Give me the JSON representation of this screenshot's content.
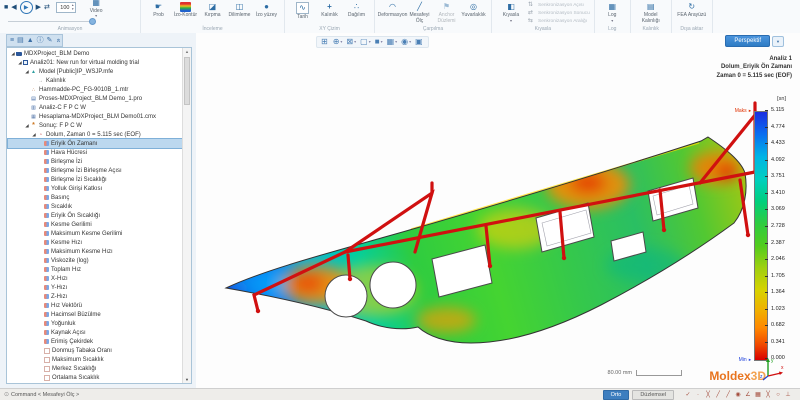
{
  "ribbon": {
    "animation": {
      "label": "Animasyon",
      "value": "100",
      "icons": {
        "stop": "■",
        "prev": "◀",
        "play": "▶",
        "next": "▶",
        "loop": "⇄"
      },
      "video": {
        "label": "Video",
        "glyph": "▦"
      }
    },
    "inceleme": {
      "label": "İnceleme",
      "buttons": [
        {
          "name": "prob-button",
          "label": "Prob",
          "glyph": "☛"
        },
        {
          "name": "izo-kontur-button",
          "label": "İzo-Kontür",
          "glyph": "",
          "iconclass": "rainbow"
        },
        {
          "name": "kirpma-button",
          "label": "Kırpma",
          "glyph": "◪"
        },
        {
          "name": "dilimleme-button",
          "label": "Dilimleme",
          "glyph": "◫"
        },
        {
          "name": "izo-yuzey-button",
          "label": "İzo yüzey",
          "glyph": "●"
        }
      ]
    },
    "xy": {
      "label": "XY Çizim",
      "buttons": [
        {
          "name": "tarih-button",
          "label": "Tarih",
          "glyph": "∿",
          "iconclass": "chart"
        },
        {
          "name": "kalinlik-button",
          "label": "Kalınlık",
          "glyph": "+",
          "iconclass": "red"
        },
        {
          "name": "dagilim-button",
          "label": "Dağılım",
          "glyph": "∴"
        }
      ]
    },
    "carpilma": {
      "label": "Çarpılma",
      "buttons": [
        {
          "name": "deformasyon-button",
          "label": "Deformasyon",
          "glyph": "◠"
        },
        {
          "name": "mesafeyi-olc-button",
          "label": "Mesafeyi Ölç",
          "glyph": "╱"
        },
        {
          "name": "anchor-duzlemi-button",
          "label": "Anchor Düzlemi",
          "glyph": "⚑",
          "disabled": true
        },
        {
          "name": "yuvarlaklik-button",
          "label": "Yuvarlaklık",
          "glyph": "◎",
          "iconclass": "red"
        }
      ]
    },
    "kiyasla": {
      "label": "Kıyasla",
      "main": {
        "label": "Kıyasla",
        "glyph": "◧"
      },
      "subs": [
        {
          "name": "senkronizasyon-acisi-button",
          "label": "Senkronizasyon Açısı",
          "glyph": "⇅",
          "disabled": true
        },
        {
          "name": "senkronizasyon-sonucu-button",
          "label": "Senkronizasyon Sonucu",
          "glyph": "⇄",
          "disabled": true
        },
        {
          "name": "senkronizasyon-araligi-button",
          "label": "Senkronizasyon Aralığı",
          "glyph": "⇆",
          "disabled": true
        }
      ]
    },
    "log": {
      "label": "Log",
      "button": {
        "label": "Log",
        "glyph": "▦"
      }
    },
    "kalinlik": {
      "label": "Kalınlık",
      "button": {
        "label": "Model Kalınlığı",
        "glyph": "▤",
        "iconclass": "tan"
      }
    },
    "disa": {
      "label": "Dışa aktar",
      "button": {
        "label": "FEA Arayüzü",
        "glyph": "↻"
      }
    }
  },
  "tree": {
    "head_icons": [
      {
        "name": "tree-list-icon",
        "glyph": "≡"
      },
      {
        "name": "tree-layers-icon",
        "glyph": "▤"
      },
      {
        "name": "tree-model-icon",
        "glyph": "▲"
      },
      {
        "name": "tree-info-icon",
        "glyph": "ⓘ"
      },
      {
        "name": "tree-tools-icon",
        "glyph": "✎"
      },
      {
        "name": "collapse-all-icon",
        "glyph": "«",
        "iconclass": "rot90"
      }
    ],
    "items": [
      {
        "label": "MDXProject_BLM Demo",
        "level": 0,
        "icon": "folder",
        "caret": "◢"
      },
      {
        "label": "Analiz01: New run for virtual molding trial",
        "level": 1,
        "icon": "run",
        "caret": "◢"
      },
      {
        "label": "Model [Public]IP_WSJP.mfe",
        "level": 2,
        "icon": "model",
        "caret": "◢"
      },
      {
        "label": "Kalınlık",
        "level": 3,
        "icon": "thick",
        "caret": ""
      },
      {
        "label": "Hammadde-PC_FG-9010B_1.mtr",
        "level": 2,
        "icon": "mtr",
        "caret": ""
      },
      {
        "label": "Proses-MDXProject_BLM Demo_1.pro",
        "level": 2,
        "icon": "pro",
        "caret": ""
      },
      {
        "label": "Analiz-C F P C W",
        "level": 2,
        "icon": "ana",
        "caret": ""
      },
      {
        "label": "Hesaplama-MDXProject_BLM Demo01.cmx",
        "level": 2,
        "icon": "cmx",
        "caret": ""
      },
      {
        "label": "Sonuç: F P C W",
        "level": 2,
        "icon": "res",
        "caret": "◢"
      },
      {
        "label": "Dolum, Zaman 0 = 5.115 sec (EOF)",
        "level": 3,
        "icon": "fill",
        "caret": "◢"
      },
      {
        "label": "Eriyik Ön Zamanı",
        "level": 4,
        "icon": "item",
        "caret": "",
        "selected": true
      },
      {
        "label": "Hava Hücresi",
        "level": 4,
        "icon": "item",
        "caret": ""
      },
      {
        "label": "Birleşme İzi",
        "level": 4,
        "icon": "item",
        "caret": ""
      },
      {
        "label": "Birleşme İzi Birleşme Açısı",
        "level": 4,
        "icon": "item",
        "caret": ""
      },
      {
        "label": "Birleşme İzi Sıcaklığı",
        "level": 4,
        "icon": "item",
        "caret": ""
      },
      {
        "label": "Yolluk Girişi Katkısı",
        "level": 4,
        "icon": "item",
        "caret": ""
      },
      {
        "label": "Basınç",
        "level": 4,
        "icon": "item",
        "caret": ""
      },
      {
        "label": "Sıcaklık",
        "level": 4,
        "icon": "item",
        "caret": ""
      },
      {
        "label": "Eriyik Ön Sıcaklığı",
        "level": 4,
        "icon": "item",
        "caret": ""
      },
      {
        "label": "Kesme Gerilimi",
        "level": 4,
        "icon": "item",
        "caret": ""
      },
      {
        "label": "Maksimum Kesme Gerilimi",
        "level": 4,
        "icon": "item",
        "caret": ""
      },
      {
        "label": "Kesme Hızı",
        "level": 4,
        "icon": "item",
        "caret": ""
      },
      {
        "label": "Maksimum Kesme Hızı",
        "level": 4,
        "icon": "item",
        "caret": ""
      },
      {
        "label": "Viskozite (log)",
        "level": 4,
        "icon": "item",
        "caret": ""
      },
      {
        "label": "Toplam Hız",
        "level": 4,
        "icon": "item",
        "caret": ""
      },
      {
        "label": "X-Hızı",
        "level": 4,
        "icon": "item",
        "caret": ""
      },
      {
        "label": "Y-Hızı",
        "level": 4,
        "icon": "item",
        "caret": ""
      },
      {
        "label": "Z-Hızı",
        "level": 4,
        "icon": "item",
        "caret": ""
      },
      {
        "label": "Hız Vektörü",
        "level": 4,
        "icon": "item",
        "caret": ""
      },
      {
        "label": "Hacimsel Büzülme",
        "level": 4,
        "icon": "item",
        "caret": ""
      },
      {
        "label": "Yoğunluk",
        "level": 4,
        "icon": "item",
        "caret": ""
      },
      {
        "label": "Kaynak Açısı",
        "level": 4,
        "icon": "item",
        "caret": ""
      },
      {
        "label": "Erimiş Çekirdek",
        "level": 4,
        "icon": "item",
        "caret": ""
      },
      {
        "label": "Donmuş Tabaka Oranı",
        "level": 4,
        "icon": "item2",
        "caret": ""
      },
      {
        "label": "Maksimum Sıcaklık",
        "level": 4,
        "icon": "item2",
        "caret": ""
      },
      {
        "label": "Merkez Sıcaklığı",
        "level": 4,
        "icon": "item2",
        "caret": ""
      },
      {
        "label": "Ortalama Sıcaklık",
        "level": 4,
        "icon": "item2",
        "caret": ""
      }
    ]
  },
  "viewport": {
    "toolbar_icons": [
      {
        "name": "fit-view-icon",
        "glyph": "⊞",
        "caret": ""
      },
      {
        "name": "zoom-icon",
        "glyph": "⊕",
        "caret": "▾"
      },
      {
        "name": "pan-icon",
        "glyph": "⊠",
        "caret": "▾"
      },
      {
        "name": "view-orientation-icon",
        "glyph": "▢",
        "caret": "▾"
      },
      {
        "name": "shaded-mode-icon",
        "glyph": "■",
        "caret": "▾"
      },
      {
        "name": "mesh-mode-icon",
        "glyph": "▦",
        "caret": "▾"
      },
      {
        "name": "clip-mode-icon",
        "glyph": "◉",
        "caret": "▾"
      },
      {
        "name": "display-options-icon",
        "glyph": "▣",
        "caret": ""
      }
    ],
    "view_mode": "Perspektif",
    "result_lines": [
      "Analiz 1",
      "Dolum_Eriyik Ön Zamanı",
      "Zaman 0 = 5.115 sec (EOF)"
    ],
    "scale_label": "80.00 mm",
    "logo": {
      "part1": "Moldex",
      "part2": "3D"
    },
    "axes": {
      "x": "x",
      "y": "y",
      "z": "z"
    }
  },
  "legend": {
    "unit": "[sn]",
    "max_label": "Maks",
    "min_label": "Min",
    "values": [
      "5.115",
      "4.774",
      "4.433",
      "4.092",
      "3.751",
      "3.410",
      "3.069",
      "2.728",
      "2.387",
      "2.046",
      "1.705",
      "1.364",
      "1.023",
      "0.682",
      "0.341",
      "0.000"
    ]
  },
  "statusbar": {
    "command": "Command < Mesafeyi Ölç >",
    "ortho": "Orto",
    "planar": "Düzlemsel",
    "snaps": [
      {
        "name": "select-check-icon",
        "glyph": "✓"
      },
      {
        "name": "snap-point-icon",
        "glyph": "·"
      },
      {
        "name": "snap-endpoint-icon",
        "glyph": "╳"
      },
      {
        "name": "snap-line-icon",
        "glyph": "╱"
      },
      {
        "name": "snap-midline-icon",
        "glyph": "╱"
      },
      {
        "name": "snap-center-icon",
        "glyph": "◉"
      },
      {
        "name": "snap-angle-icon",
        "glyph": "∠"
      },
      {
        "name": "snap-grid-icon",
        "glyph": "▦"
      },
      {
        "name": "snap-intersect-icon",
        "glyph": "╳"
      },
      {
        "name": "snap-circle-icon",
        "glyph": "○"
      },
      {
        "name": "snap-perpendicular-icon",
        "glyph": "⊥"
      }
    ]
  },
  "colors": {
    "accent_blue": "#2e75b6",
    "selection": "#bcd8ef",
    "runner_red": "#d01010",
    "logo_orange": "#e8741e",
    "legend_max": "#1b2fe0",
    "legend_min": "#d80000"
  }
}
